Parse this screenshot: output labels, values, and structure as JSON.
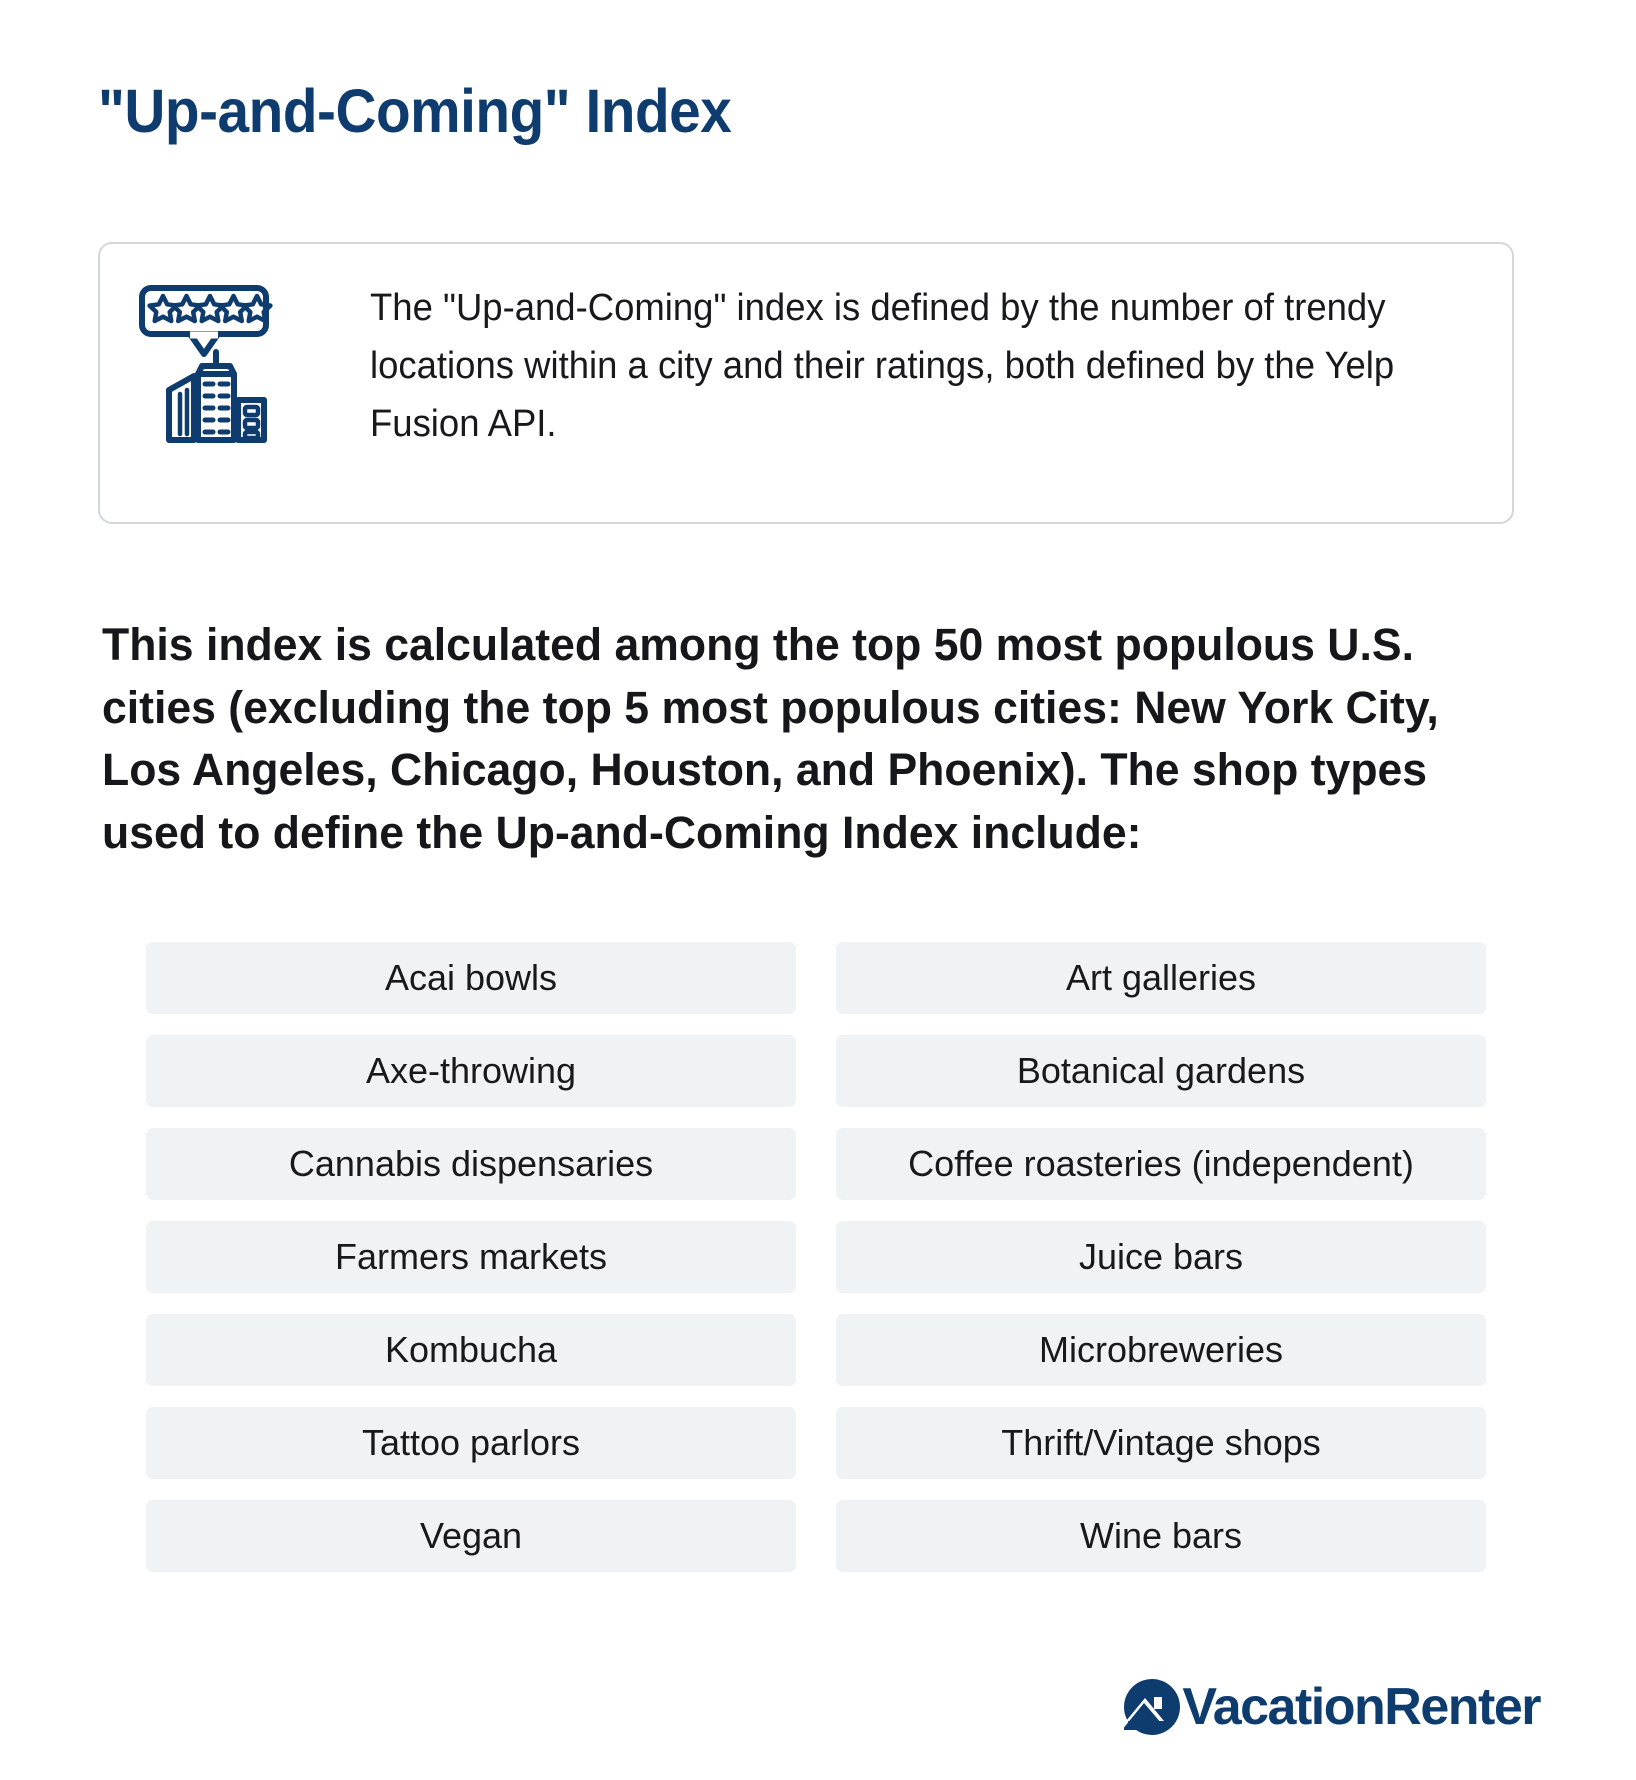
{
  "page": {
    "title": "\"Up-and-Coming\" Index",
    "background_color": "#ffffff",
    "brand_color": "#0e3c6e",
    "pill_color": "#eff3f6"
  },
  "info_card": {
    "icon_name": "five-star-rating-city-buildings-icon",
    "text": "The \"Up-and-Coming\" index is defined by the number of trendy locations within a city and their ratings, both defined by the Yelp Fusion API."
  },
  "lead": {
    "text": "This index is calculated among the top 50 most populous U.S. cities (excluding the top 5 most populous cities: New York City, Los Angeles, Chicago, Houston, and Phoenix). The shop types used to define the Up-and-Coming Index include:"
  },
  "shop_types": {
    "left_column": [
      "Acai bowls",
      "Axe-throwing",
      "Cannabis dispensaries",
      "Farmers markets",
      "Kombucha",
      "Tattoo parlors",
      "Vegan"
    ],
    "right_column": [
      "Art galleries",
      "Botanical gardens",
      "Coffee roasteries (independent)",
      "Juice bars",
      "Microbreweries",
      "Thrift/Vintage shops",
      "Wine bars"
    ]
  },
  "footer": {
    "logo_icon_name": "vacationrenter-house-mountain-circle-icon",
    "logo_text_light": "Vacation",
    "logo_text_heavy": "Renter"
  }
}
